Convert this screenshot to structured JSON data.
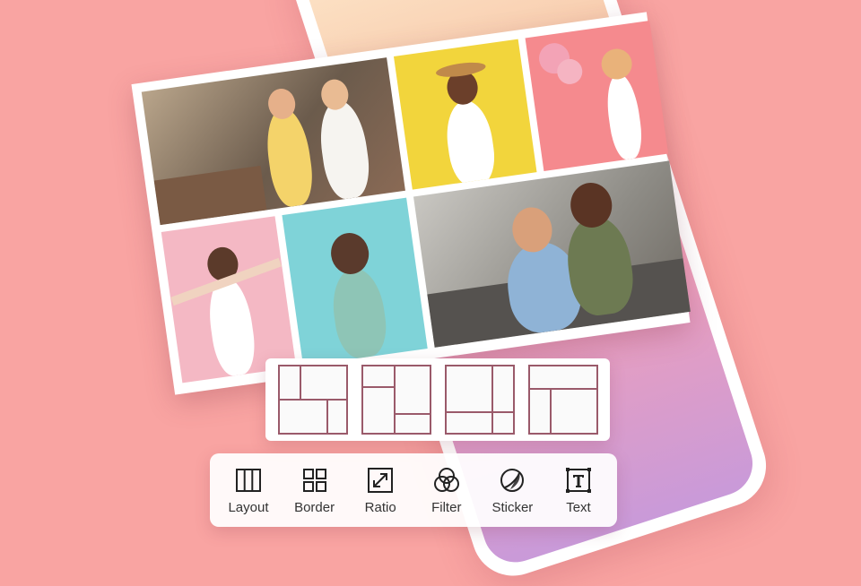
{
  "colors": {
    "background": "#f9a4a2",
    "accent": "#9a5a6a",
    "toolbar_text": "#333333"
  },
  "collage": {
    "photos": [
      {
        "name": "shopping-friends"
      },
      {
        "name": "girl-yellow-hat"
      },
      {
        "name": "woman-balloons"
      },
      {
        "name": "woman-dancing"
      },
      {
        "name": "girl-surprised"
      },
      {
        "name": "couple-sofa"
      }
    ]
  },
  "layout_options": [
    {
      "name": "layout-1"
    },
    {
      "name": "layout-2"
    },
    {
      "name": "layout-3"
    },
    {
      "name": "layout-4"
    }
  ],
  "toolbar": {
    "items": [
      {
        "label": "Layout",
        "icon": "layout-icon"
      },
      {
        "label": "Border",
        "icon": "border-icon"
      },
      {
        "label": "Ratio",
        "icon": "ratio-icon"
      },
      {
        "label": "Filter",
        "icon": "filter-icon"
      },
      {
        "label": "Sticker",
        "icon": "sticker-icon"
      },
      {
        "label": "Text",
        "icon": "text-icon"
      }
    ]
  }
}
